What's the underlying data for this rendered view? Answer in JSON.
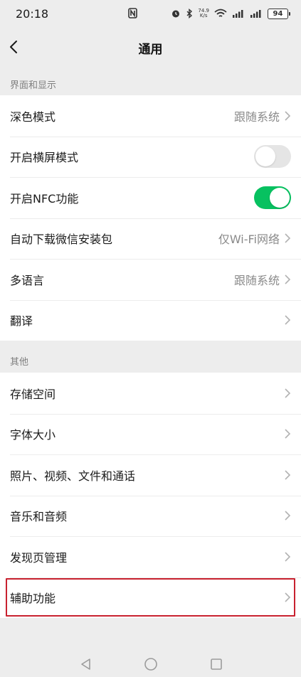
{
  "status_bar": {
    "time": "20:18",
    "net_speed_value": "74.9",
    "net_speed_unit": "K/s",
    "battery": "94"
  },
  "nav": {
    "title": "通用"
  },
  "sections": {
    "display": {
      "header": "界面和显示",
      "items": [
        {
          "label": "深色模式",
          "value": "跟随系统"
        },
        {
          "label": "开启横屏模式",
          "toggle": false
        },
        {
          "label": "开启NFC功能",
          "toggle": true
        },
        {
          "label": "自动下载微信安装包",
          "value": "仅Wi-Fi网络"
        },
        {
          "label": "多语言",
          "value": "跟随系统"
        },
        {
          "label": "翻译"
        }
      ]
    },
    "other": {
      "header": "其他",
      "items": [
        {
          "label": "存储空间"
        },
        {
          "label": "字体大小"
        },
        {
          "label": "照片、视频、文件和通话"
        },
        {
          "label": "音乐和音频"
        },
        {
          "label": "发现页管理"
        },
        {
          "label": "辅助功能"
        }
      ]
    }
  },
  "colors": {
    "accent_green": "#07c160",
    "highlight_red": "#c8212f",
    "background": "#ededed"
  }
}
